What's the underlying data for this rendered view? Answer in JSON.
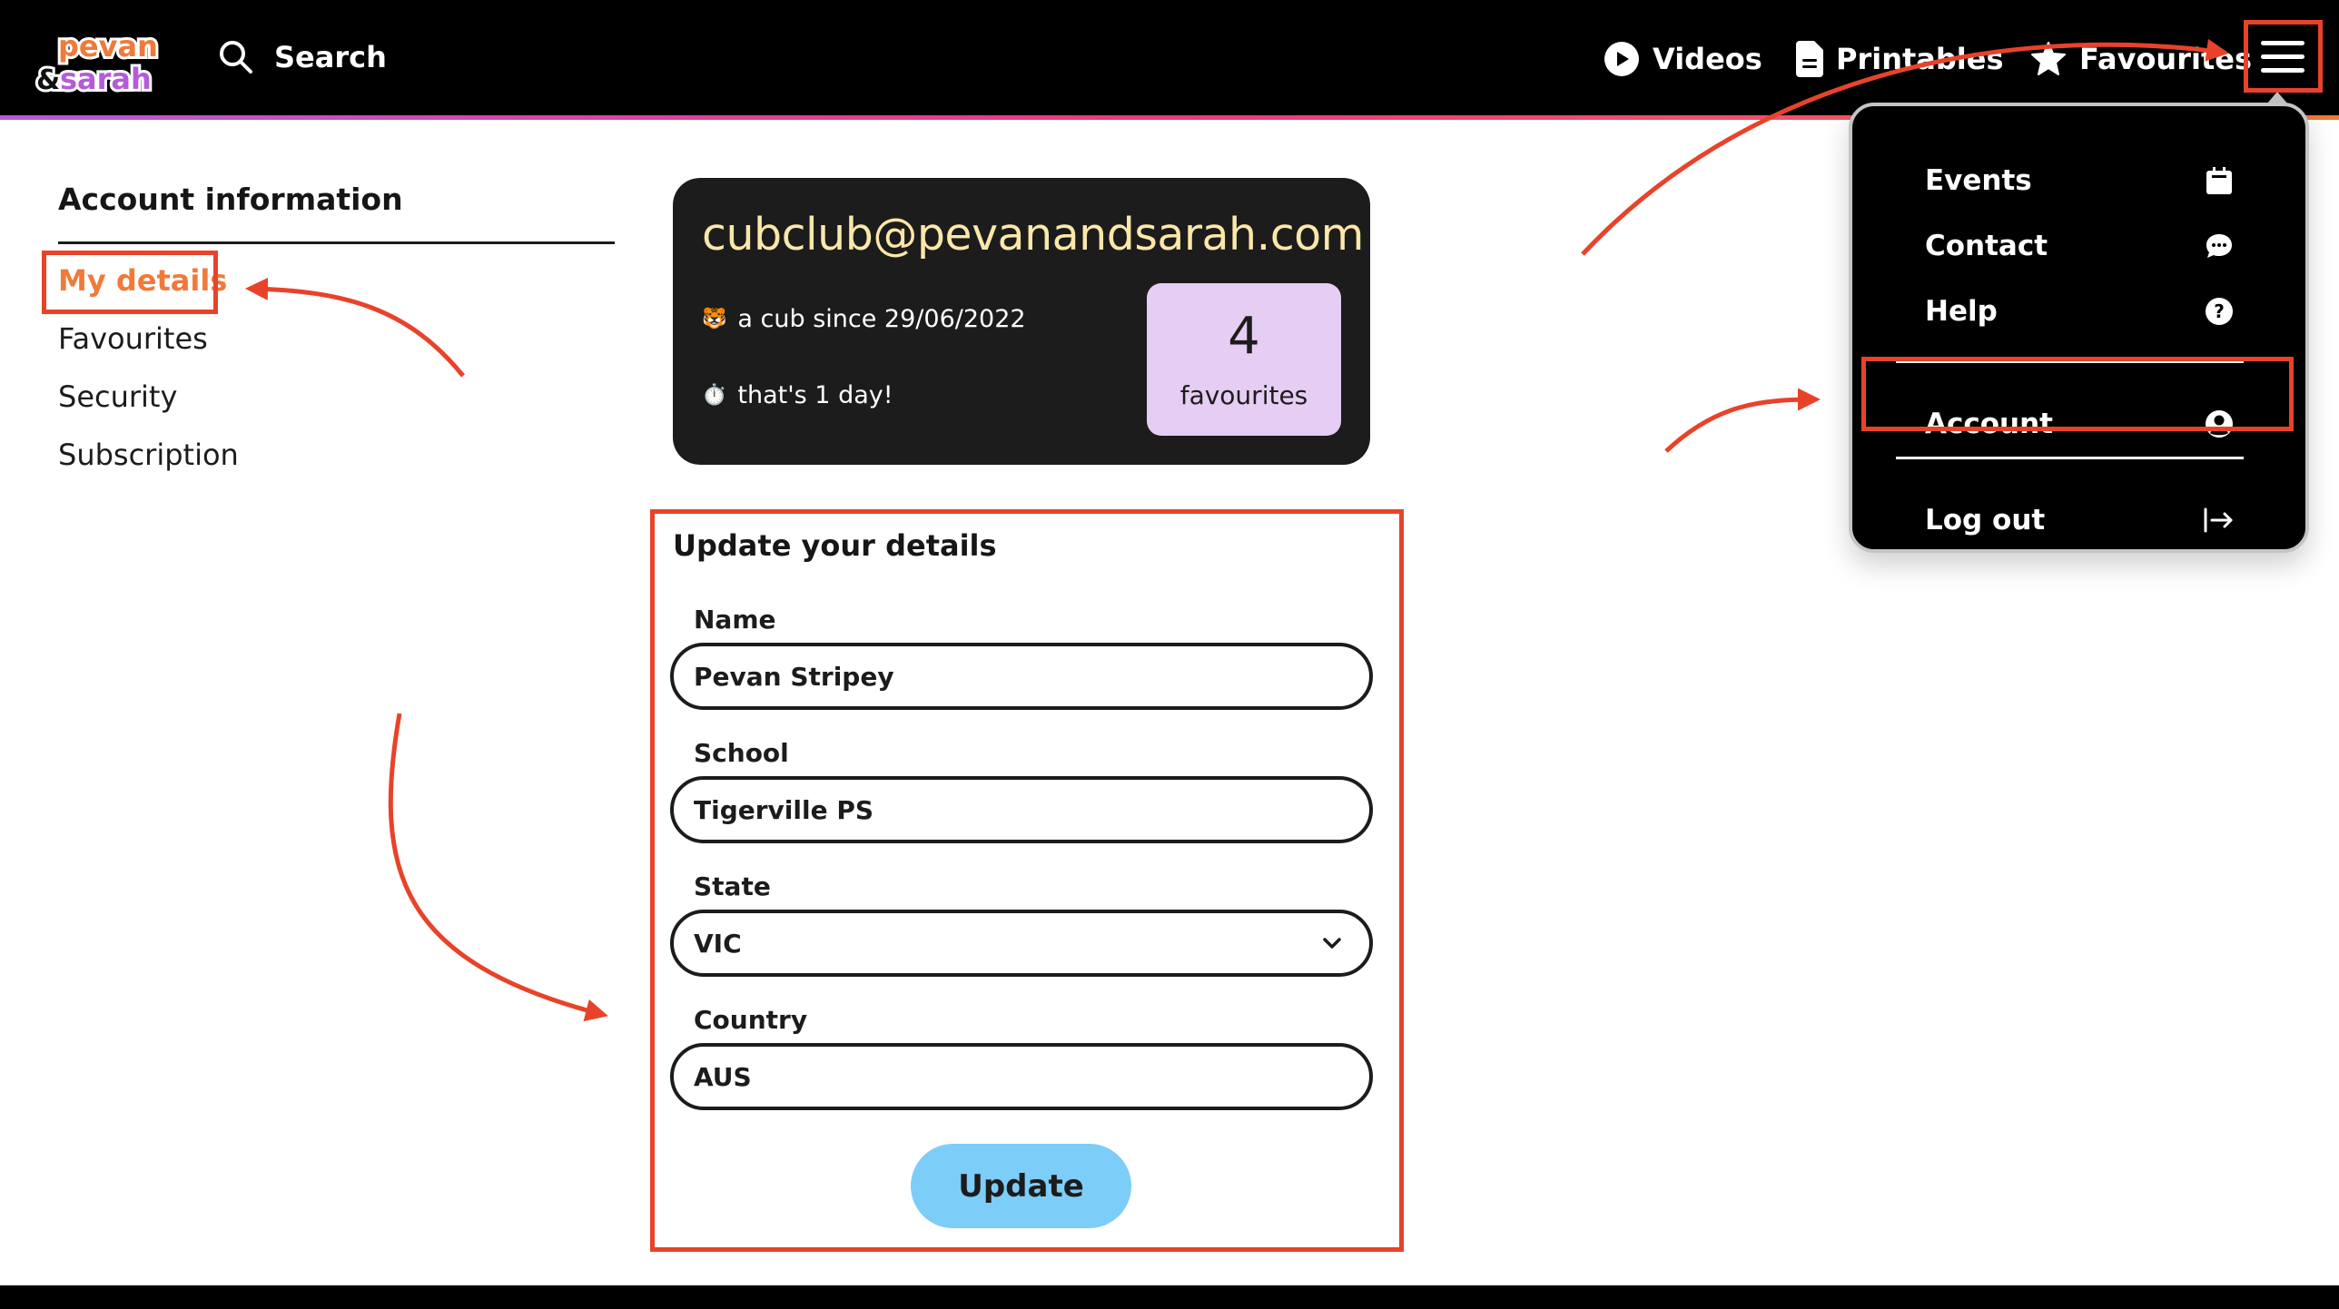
{
  "header": {
    "logo_alt": "Pevan & Sarah",
    "logo_top_word": "pevan",
    "logo_bottom_word": "sarah",
    "logo_amp": "&",
    "search_label": "Search",
    "search_icon": "search-icon",
    "nav": [
      {
        "label": "Videos",
        "icon": "play-circle-icon"
      },
      {
        "label": "Printables",
        "icon": "document-icon"
      },
      {
        "label": "Favourites",
        "icon": "star-icon"
      }
    ],
    "menu_icon": "hamburger-icon"
  },
  "dropdown": {
    "items": [
      {
        "label": "Events",
        "icon": "calendar-icon"
      },
      {
        "label": "Contact",
        "icon": "chat-bubble-icon"
      },
      {
        "label": "Help",
        "icon": "question-circle-icon"
      },
      {
        "label": "Account",
        "icon": "user-circle-icon"
      },
      {
        "label": "Log out",
        "icon": "logout-arrow-icon"
      }
    ]
  },
  "sidebar": {
    "title": "Account information",
    "items": [
      {
        "label": "My details",
        "active": true
      },
      {
        "label": "Favourites",
        "active": false
      },
      {
        "label": "Security",
        "active": false
      },
      {
        "label": "Subscription",
        "active": false
      }
    ]
  },
  "profile": {
    "email": "cubclub@pevanandsarah.com",
    "member_since_emoji": "🐯",
    "member_since": "a cub since 29/06/2022",
    "duration_emoji": "⏱️",
    "duration": "that's 1 day!",
    "favourites_count": "4",
    "favourites_label": "favourites"
  },
  "form": {
    "title": "Update your details",
    "fields": [
      {
        "label": "Name",
        "value": "Pevan Stripey",
        "type": "text"
      },
      {
        "label": "School",
        "value": "Tigerville PS",
        "type": "text"
      },
      {
        "label": "State",
        "value": "VIC",
        "type": "select"
      },
      {
        "label": "Country",
        "value": "AUS",
        "type": "text"
      }
    ],
    "submit_label": "Update"
  },
  "colors": {
    "accent_orange": "#f07a3a",
    "accent_purple": "#b35bd9",
    "accent_pink": "#ee3a78",
    "button_blue": "#7dcdf9",
    "fav_box": "#e6cdf3",
    "email_yellow": "#fbe7a8",
    "annotation_red": "#e8432a"
  }
}
